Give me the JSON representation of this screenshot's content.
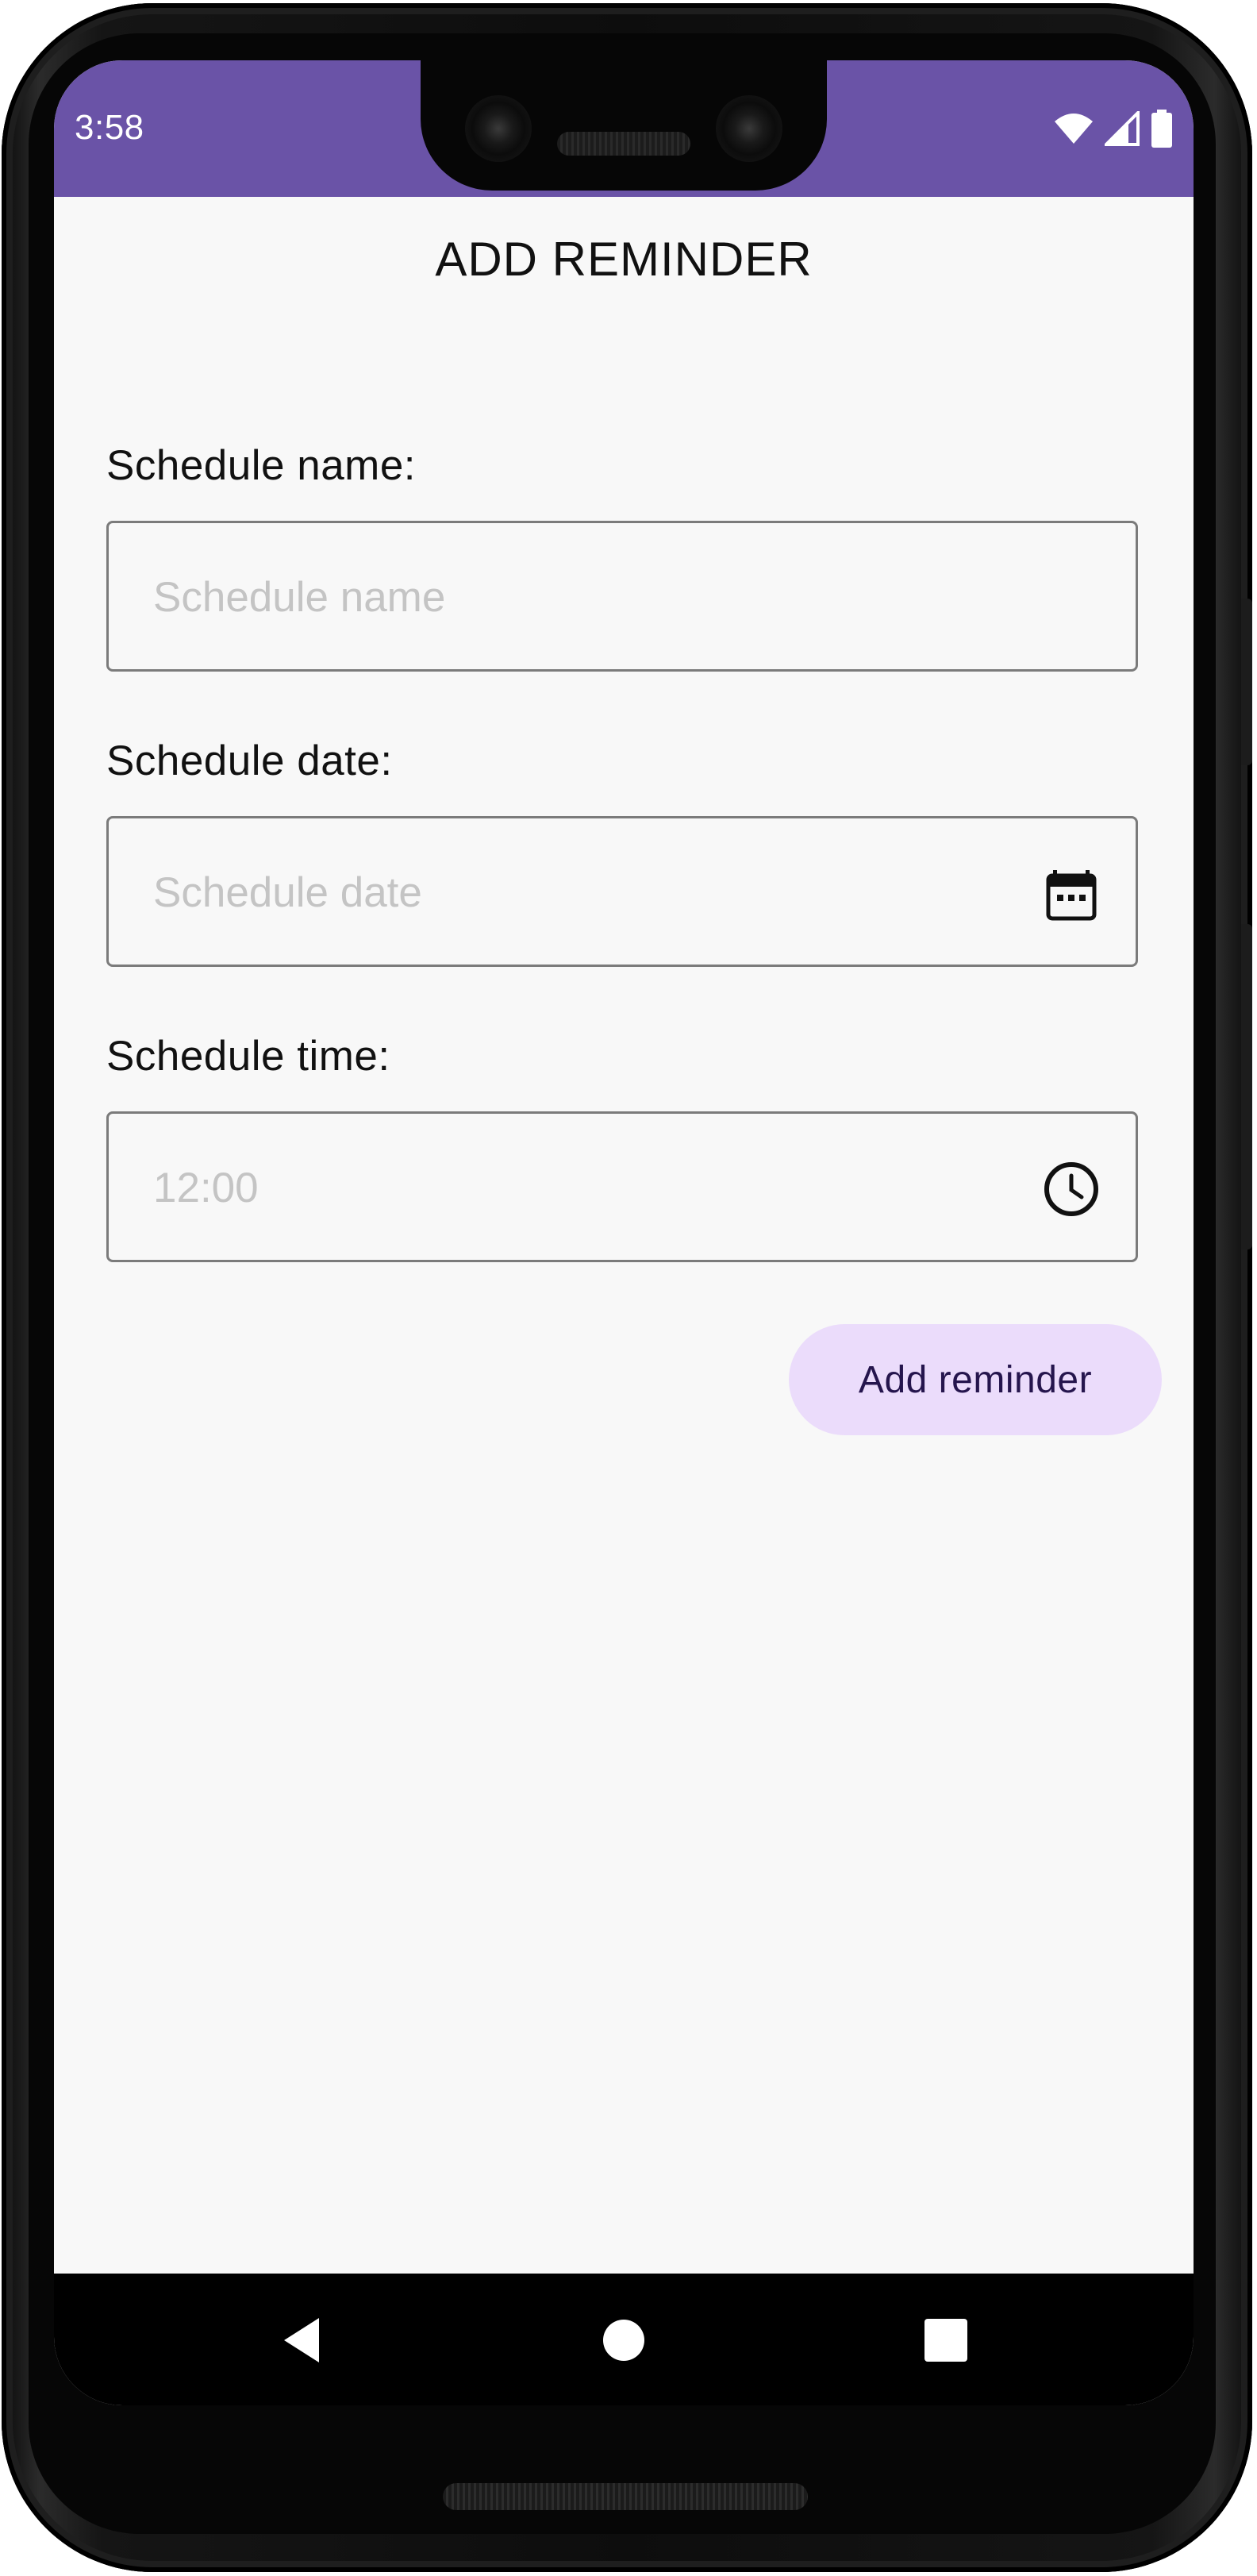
{
  "status_bar": {
    "time": "3:58",
    "background": "#6a53a7",
    "icons": [
      "wifi-icon",
      "signal-icon",
      "battery-icon"
    ]
  },
  "page": {
    "title": "ADD REMINDER"
  },
  "form": {
    "name": {
      "label": "Schedule name:",
      "placeholder": "Schedule name",
      "value": ""
    },
    "date": {
      "label": "Schedule date:",
      "placeholder": "Schedule date",
      "value": "",
      "icon": "calendar-icon"
    },
    "time": {
      "label": "Schedule time:",
      "placeholder": "12:00",
      "value": "",
      "icon": "clock-icon"
    },
    "submit_label": "Add reminder"
  },
  "nav_bar": {
    "buttons": [
      "back-icon",
      "home-icon",
      "recents-icon"
    ]
  },
  "colors": {
    "accent": "#6a53a7",
    "button_bg": "#ebdcfb",
    "button_text": "#25154d"
  }
}
